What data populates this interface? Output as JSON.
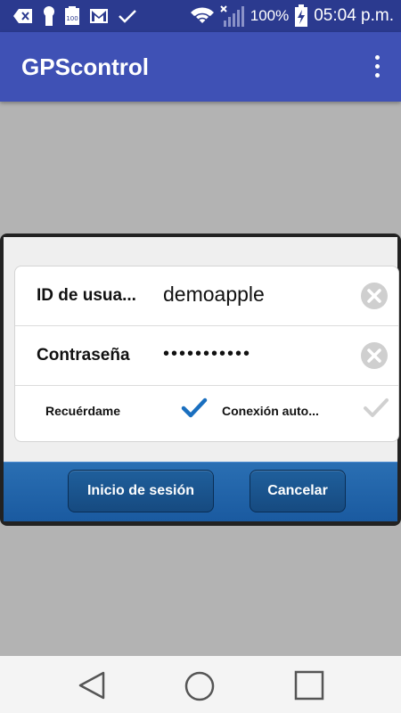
{
  "status_bar": {
    "battery_percent": "100%",
    "time": "05:04 p.m."
  },
  "app_bar": {
    "title": "GPScontrol"
  },
  "login_form": {
    "user_id_label": "ID de usua...",
    "user_id_value": "demoapple",
    "password_label": "Contraseña",
    "password_value": "•••••••••••",
    "remember_label": "Recuérdame",
    "remember_checked": true,
    "auto_connect_label": "Conexión auto...",
    "auto_connect_checked": false,
    "login_button": "Inicio de sesión",
    "cancel_button": "Cancelar"
  },
  "colors": {
    "status_bar": "#2b3a8f",
    "app_bar": "#3f51b5",
    "button_bar": "#1f64a8",
    "check_active": "#1a6fbf",
    "check_inactive": "#d0d0d0"
  }
}
